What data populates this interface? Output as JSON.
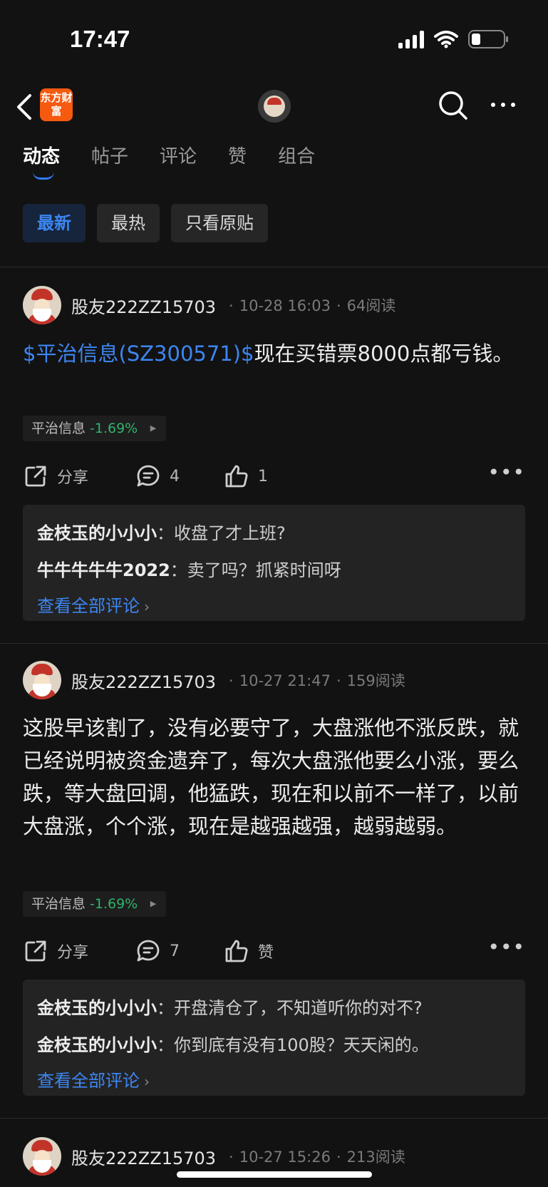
{
  "status_bar": {
    "time": "17:47"
  },
  "nav": {
    "logo_text": "东方财富"
  },
  "tabs": [
    {
      "label": "动态",
      "active": true
    },
    {
      "label": "帖子"
    },
    {
      "label": "评论"
    },
    {
      "label": "赞"
    },
    {
      "label": "组合"
    }
  ],
  "filters": [
    {
      "label": "最新",
      "active": true
    },
    {
      "label": "最热"
    },
    {
      "label": "只看原贴"
    }
  ],
  "posts": [
    {
      "user": "股友222ZZ15703",
      "date": "10-28 16:03",
      "reads": "64阅读",
      "stock_link": "$平治信息(SZ300571)$",
      "text": "现在买错票8000点都亏钱。",
      "chip_name": "平治信息",
      "chip_pct": "-1.69%",
      "share_label": "分享",
      "comment_count": "4",
      "like_label": "1",
      "comments": [
        {
          "who": "金枝玉的小小小",
          "text": "收盘了才上班?"
        },
        {
          "who": "牛牛牛牛牛2022",
          "text": "卖了吗？抓紧时间呀"
        }
      ],
      "view_all": "查看全部评论"
    },
    {
      "user": "股友222ZZ15703",
      "date": "10-27 21:47",
      "reads": "159阅读",
      "text": "这股早该割了，没有必要守了，大盘涨他不涨反跌，就已经说明被资金遗弃了，每次大盘涨他要么小涨，要么跌，等大盘回调，他猛跌，现在和以前不一样了，以前大盘涨，个个涨，现在是越强越强，越弱越弱。",
      "chip_name": "平治信息",
      "chip_pct": "-1.69%",
      "share_label": "分享",
      "comment_count": "7",
      "like_label": "赞",
      "comments": [
        {
          "who": "金枝玉的小小小",
          "text": "开盘清仓了，不知道听你的对不?"
        },
        {
          "who": "金枝玉的小小小",
          "text": "你到底有没有100股？天天闲的。"
        }
      ],
      "view_all": "查看全部评论"
    },
    {
      "user": "股友222ZZ15703",
      "date": "10-27 15:26",
      "reads": "213阅读"
    }
  ]
}
